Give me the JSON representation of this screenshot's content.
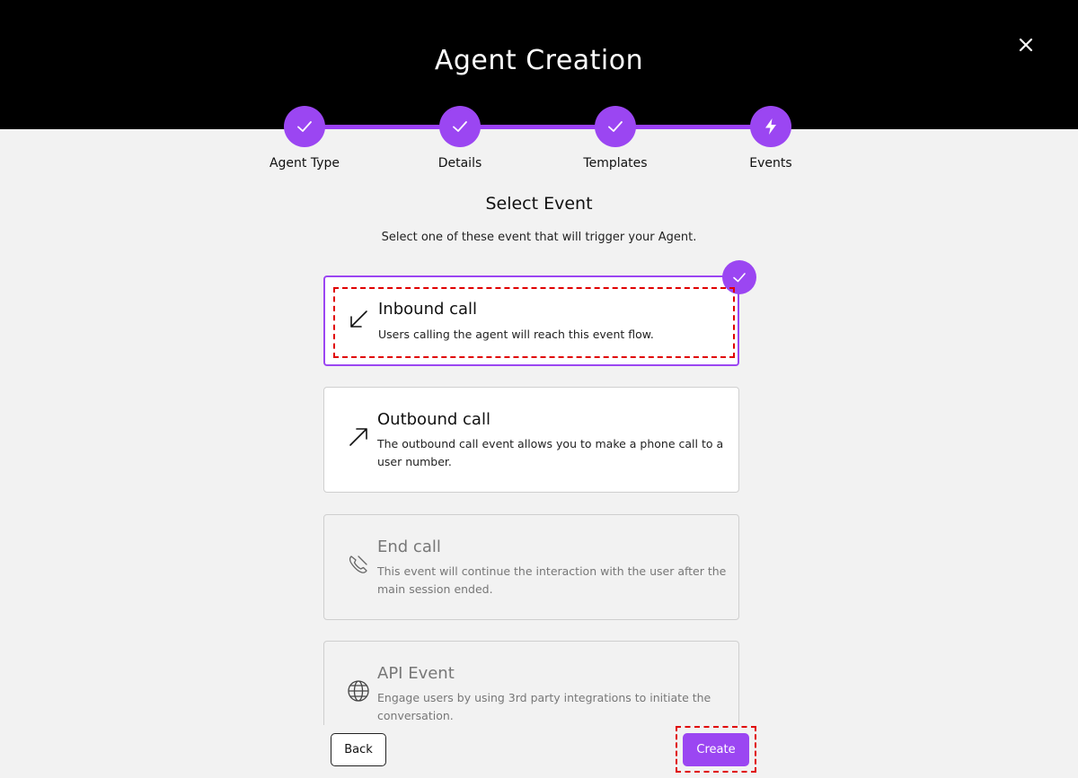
{
  "modal": {
    "title": "Agent Creation"
  },
  "stepper": {
    "steps": [
      {
        "label": "Agent Type",
        "status": "complete",
        "icon": "check-icon"
      },
      {
        "label": "Details",
        "status": "complete",
        "icon": "check-icon"
      },
      {
        "label": "Templates",
        "status": "complete",
        "icon": "check-icon"
      },
      {
        "label": "Events",
        "status": "current",
        "icon": "lightning-icon"
      }
    ]
  },
  "section": {
    "title": "Select Event",
    "subtitle": "Select one of these event that will trigger your Agent."
  },
  "events": [
    {
      "title": "Inbound call",
      "description": "Users calling the agent will reach this event flow.",
      "icon": "arrow-down-left-icon",
      "state": "selected"
    },
    {
      "title": "Outbound call",
      "description": "The outbound call event allows you to make a phone call to a user number.",
      "icon": "arrow-up-right-icon",
      "state": "enabled"
    },
    {
      "title": "End call",
      "description": "This event will continue the interaction with the user after the main session ended.",
      "icon": "phone-hangup-icon",
      "state": "disabled"
    },
    {
      "title": "API Event",
      "description": "Engage users by using 3rd party integrations to initiate the conversation.",
      "icon": "globe-icon",
      "state": "disabled"
    }
  ],
  "footer": {
    "back_label": "Back",
    "create_label": "Create"
  },
  "colors": {
    "accent": "#9b46f2",
    "header_bg": "#000000",
    "page_bg": "#f2f2f2",
    "annotation": "#e00000"
  }
}
